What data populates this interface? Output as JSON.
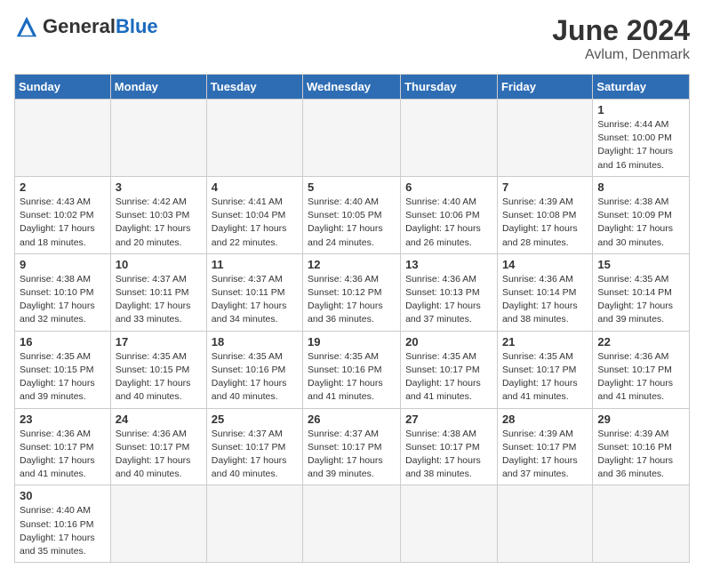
{
  "logo": {
    "text_general": "General",
    "text_blue": "Blue"
  },
  "header": {
    "month": "June 2024",
    "location": "Avlum, Denmark"
  },
  "weekdays": [
    "Sunday",
    "Monday",
    "Tuesday",
    "Wednesday",
    "Thursday",
    "Friday",
    "Saturday"
  ],
  "weeks": [
    [
      {
        "day": "",
        "empty": true
      },
      {
        "day": "",
        "empty": true
      },
      {
        "day": "",
        "empty": true
      },
      {
        "day": "",
        "empty": true
      },
      {
        "day": "",
        "empty": true
      },
      {
        "day": "",
        "empty": true
      },
      {
        "day": "1",
        "sunrise": "Sunrise: 4:44 AM",
        "sunset": "Sunset: 10:00 PM",
        "daylight": "Daylight: 17 hours and 16 minutes."
      }
    ],
    [
      {
        "day": "2",
        "sunrise": "Sunrise: 4:43 AM",
        "sunset": "Sunset: 10:02 PM",
        "daylight": "Daylight: 17 hours and 18 minutes."
      },
      {
        "day": "3",
        "sunrise": "Sunrise: 4:42 AM",
        "sunset": "Sunset: 10:03 PM",
        "daylight": "Daylight: 17 hours and 20 minutes."
      },
      {
        "day": "4",
        "sunrise": "Sunrise: 4:41 AM",
        "sunset": "Sunset: 10:04 PM",
        "daylight": "Daylight: 17 hours and 22 minutes."
      },
      {
        "day": "5",
        "sunrise": "Sunrise: 4:40 AM",
        "sunset": "Sunset: 10:05 PM",
        "daylight": "Daylight: 17 hours and 24 minutes."
      },
      {
        "day": "6",
        "sunrise": "Sunrise: 4:40 AM",
        "sunset": "Sunset: 10:06 PM",
        "daylight": "Daylight: 17 hours and 26 minutes."
      },
      {
        "day": "7",
        "sunrise": "Sunrise: 4:39 AM",
        "sunset": "Sunset: 10:08 PM",
        "daylight": "Daylight: 17 hours and 28 minutes."
      },
      {
        "day": "8",
        "sunrise": "Sunrise: 4:38 AM",
        "sunset": "Sunset: 10:09 PM",
        "daylight": "Daylight: 17 hours and 30 minutes."
      }
    ],
    [
      {
        "day": "9",
        "sunrise": "Sunrise: 4:38 AM",
        "sunset": "Sunset: 10:10 PM",
        "daylight": "Daylight: 17 hours and 32 minutes."
      },
      {
        "day": "10",
        "sunrise": "Sunrise: 4:37 AM",
        "sunset": "Sunset: 10:11 PM",
        "daylight": "Daylight: 17 hours and 33 minutes."
      },
      {
        "day": "11",
        "sunrise": "Sunrise: 4:37 AM",
        "sunset": "Sunset: 10:11 PM",
        "daylight": "Daylight: 17 hours and 34 minutes."
      },
      {
        "day": "12",
        "sunrise": "Sunrise: 4:36 AM",
        "sunset": "Sunset: 10:12 PM",
        "daylight": "Daylight: 17 hours and 36 minutes."
      },
      {
        "day": "13",
        "sunrise": "Sunrise: 4:36 AM",
        "sunset": "Sunset: 10:13 PM",
        "daylight": "Daylight: 17 hours and 37 minutes."
      },
      {
        "day": "14",
        "sunrise": "Sunrise: 4:36 AM",
        "sunset": "Sunset: 10:14 PM",
        "daylight": "Daylight: 17 hours and 38 minutes."
      },
      {
        "day": "15",
        "sunrise": "Sunrise: 4:35 AM",
        "sunset": "Sunset: 10:14 PM",
        "daylight": "Daylight: 17 hours and 39 minutes."
      }
    ],
    [
      {
        "day": "16",
        "sunrise": "Sunrise: 4:35 AM",
        "sunset": "Sunset: 10:15 PM",
        "daylight": "Daylight: 17 hours and 39 minutes."
      },
      {
        "day": "17",
        "sunrise": "Sunrise: 4:35 AM",
        "sunset": "Sunset: 10:15 PM",
        "daylight": "Daylight: 17 hours and 40 minutes."
      },
      {
        "day": "18",
        "sunrise": "Sunrise: 4:35 AM",
        "sunset": "Sunset: 10:16 PM",
        "daylight": "Daylight: 17 hours and 40 minutes."
      },
      {
        "day": "19",
        "sunrise": "Sunrise: 4:35 AM",
        "sunset": "Sunset: 10:16 PM",
        "daylight": "Daylight: 17 hours and 41 minutes."
      },
      {
        "day": "20",
        "sunrise": "Sunrise: 4:35 AM",
        "sunset": "Sunset: 10:17 PM",
        "daylight": "Daylight: 17 hours and 41 minutes."
      },
      {
        "day": "21",
        "sunrise": "Sunrise: 4:35 AM",
        "sunset": "Sunset: 10:17 PM",
        "daylight": "Daylight: 17 hours and 41 minutes."
      },
      {
        "day": "22",
        "sunrise": "Sunrise: 4:36 AM",
        "sunset": "Sunset: 10:17 PM",
        "daylight": "Daylight: 17 hours and 41 minutes."
      }
    ],
    [
      {
        "day": "23",
        "sunrise": "Sunrise: 4:36 AM",
        "sunset": "Sunset: 10:17 PM",
        "daylight": "Daylight: 17 hours and 41 minutes."
      },
      {
        "day": "24",
        "sunrise": "Sunrise: 4:36 AM",
        "sunset": "Sunset: 10:17 PM",
        "daylight": "Daylight: 17 hours and 40 minutes."
      },
      {
        "day": "25",
        "sunrise": "Sunrise: 4:37 AM",
        "sunset": "Sunset: 10:17 PM",
        "daylight": "Daylight: 17 hours and 40 minutes."
      },
      {
        "day": "26",
        "sunrise": "Sunrise: 4:37 AM",
        "sunset": "Sunset: 10:17 PM",
        "daylight": "Daylight: 17 hours and 39 minutes."
      },
      {
        "day": "27",
        "sunrise": "Sunrise: 4:38 AM",
        "sunset": "Sunset: 10:17 PM",
        "daylight": "Daylight: 17 hours and 38 minutes."
      },
      {
        "day": "28",
        "sunrise": "Sunrise: 4:39 AM",
        "sunset": "Sunset: 10:17 PM",
        "daylight": "Daylight: 17 hours and 37 minutes."
      },
      {
        "day": "29",
        "sunrise": "Sunrise: 4:39 AM",
        "sunset": "Sunset: 10:16 PM",
        "daylight": "Daylight: 17 hours and 36 minutes."
      }
    ],
    [
      {
        "day": "30",
        "sunrise": "Sunrise: 4:40 AM",
        "sunset": "Sunset: 10:16 PM",
        "daylight": "Daylight: 17 hours and 35 minutes."
      },
      {
        "day": "",
        "empty": true
      },
      {
        "day": "",
        "empty": true
      },
      {
        "day": "",
        "empty": true
      },
      {
        "day": "",
        "empty": true
      },
      {
        "day": "",
        "empty": true
      },
      {
        "day": "",
        "empty": true
      }
    ]
  ]
}
